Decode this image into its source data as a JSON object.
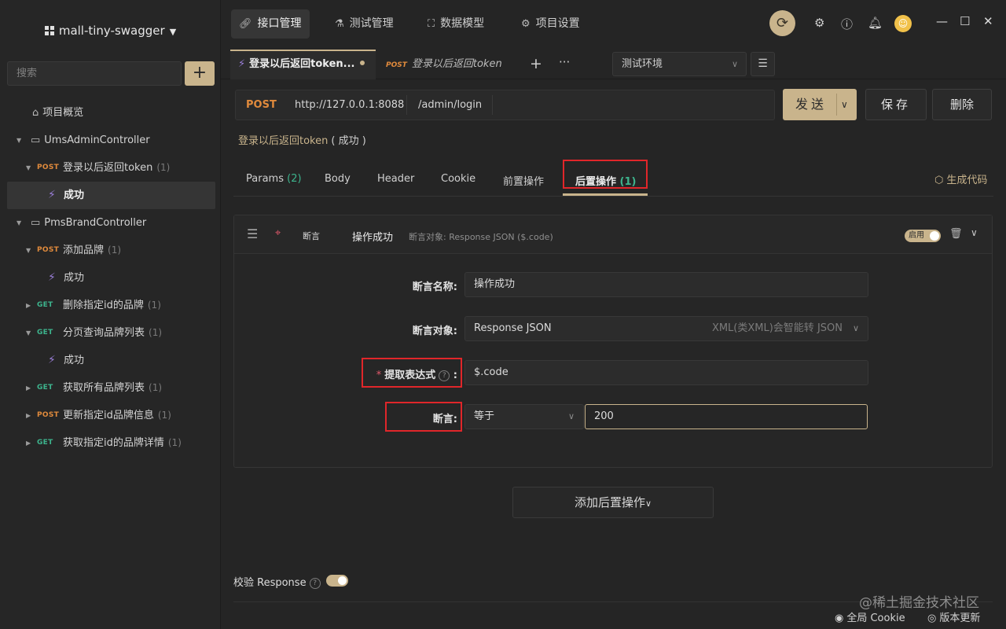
{
  "sidebar": {
    "project_name": "mall-tiny-swagger",
    "search_placeholder": "搜索",
    "add_label": "+",
    "items": [
      {
        "label": "项目概览"
      },
      {
        "label": "UmsAdminController"
      },
      {
        "method": "POST",
        "label": "登录以后返回token",
        "count": "(1)"
      },
      {
        "label": "成功"
      },
      {
        "label": "PmsBrandController"
      },
      {
        "method": "POST",
        "label": "添加品牌",
        "count": "(1)"
      },
      {
        "label": "成功"
      },
      {
        "method": "GET",
        "label": "删除指定id的品牌",
        "count": "(1)"
      },
      {
        "method": "GET",
        "label": "分页查询品牌列表",
        "count": "(1)"
      },
      {
        "label": "成功"
      },
      {
        "method": "GET",
        "label": "获取所有品牌列表",
        "count": "(1)"
      },
      {
        "method": "POST",
        "label": "更新指定id品牌信息",
        "count": "(1)"
      },
      {
        "method": "GET",
        "label": "获取指定id的品牌详情",
        "count": "(1)"
      }
    ]
  },
  "topnav": {
    "tabs": [
      {
        "label": "接口管理",
        "icon": "link-icon"
      },
      {
        "label": "测试管理",
        "icon": "flask-icon"
      },
      {
        "label": "数据模型",
        "icon": "model-icon"
      },
      {
        "label": "项目设置",
        "icon": "gear-icon"
      }
    ]
  },
  "request_tabs": {
    "active": {
      "label": "登录以后返回token..."
    },
    "inactive": {
      "method": "POST",
      "label": "登录以后返回token"
    },
    "plus": "+",
    "more": "···"
  },
  "environment": {
    "selected": "测试环境"
  },
  "request": {
    "method": "POST",
    "host": "http://127.0.0.1:8088",
    "path": "/admin/login",
    "send_label": "发送",
    "save_label": "保存",
    "delete_label": "删除"
  },
  "api_title": {
    "name": "登录以后返回token",
    "status": "( 成功 )"
  },
  "param_tabs": [
    {
      "label": "Params",
      "count": "(2)"
    },
    {
      "label": "Body"
    },
    {
      "label": "Header"
    },
    {
      "label": "Cookie"
    },
    {
      "label": "前置操作"
    },
    {
      "label": "后置操作",
      "count": "(1)"
    }
  ],
  "gen_code_label": "生成代码",
  "assertion": {
    "type_label": "断言",
    "name": "操作成功",
    "description": "断言对象: Response JSON ($.code)",
    "enabled_label": "启用",
    "form": {
      "name_label": "断言名称:",
      "name_value": "操作成功",
      "target_label": "断言对象:",
      "target_value": "Response JSON",
      "target_hint": "XML(类XML)会智能转 JSON",
      "expr_label": "提取表达式",
      "expr_value": "$.code",
      "assert_label": "断言:",
      "operator": "等于",
      "expected": "200"
    }
  },
  "add_post_label": "添加后置操作",
  "verify_response_label": "校验 Response",
  "watermark": "@稀土掘金技术社区",
  "statusbar": {
    "cookie": "全局 Cookie",
    "update": "版本更新"
  },
  "colors": {
    "accent": "#c9b48c",
    "post": "#e08a3c",
    "get": "#3db48d",
    "highlight_box": "#e0262a"
  }
}
